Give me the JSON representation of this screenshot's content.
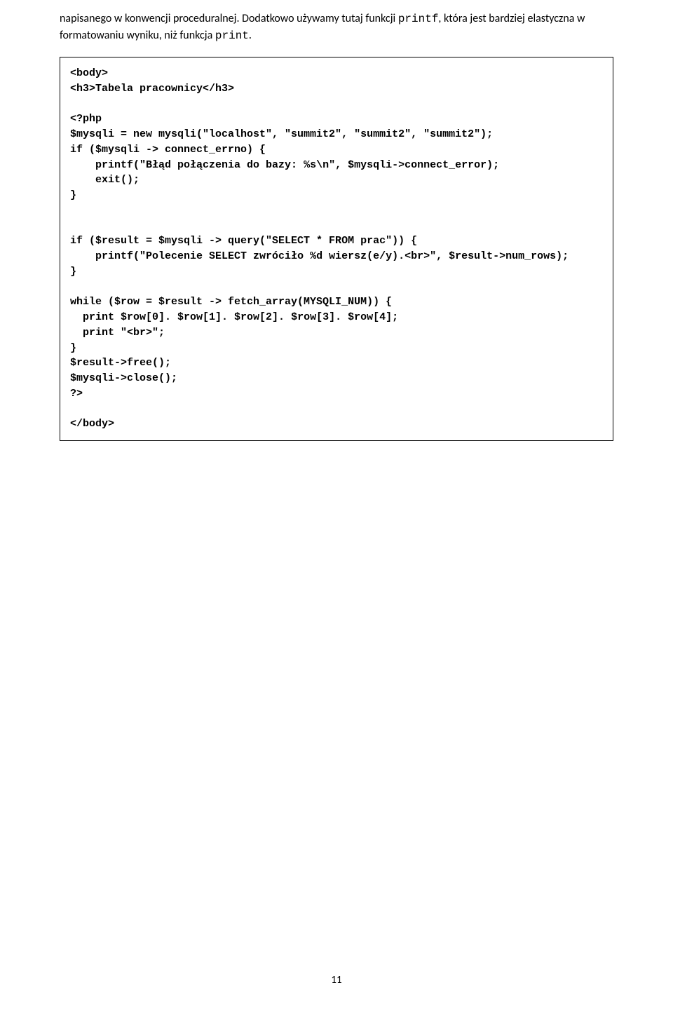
{
  "intro": {
    "part1": "napisanego w konwencji proceduralnej. Dodatkowo używamy tutaj funkcji ",
    "mono1": "printf",
    "part2": ", która jest bardziej elastyczna w formatowaniu wyniku, niż funkcja ",
    "mono2": "print",
    "part3": "."
  },
  "code": "<body>\n<h3>Tabela pracownicy</h3>\n\n<?php\n$mysqli = new mysqli(\"localhost\", \"summit2\", \"summit2\", \"summit2\");\nif ($mysqli -> connect_errno) {\n    printf(\"Błąd połączenia do bazy: %s\\n\", $mysqli->connect_error);\n    exit();\n}\n\n\nif ($result = $mysqli -> query(\"SELECT * FROM prac\")) {\n    printf(\"Polecenie SELECT zwróciło %d wiersz(e/y).<br>\", $result->num_rows);\n}\n\nwhile ($row = $result -> fetch_array(MYSQLI_NUM)) {\n  print $row[0]. $row[1]. $row[2]. $row[3]. $row[4];\n  print \"<br>\";\n}\n$result->free();\n$mysqli->close();\n?>\n\n</body>",
  "pageNumber": "11"
}
